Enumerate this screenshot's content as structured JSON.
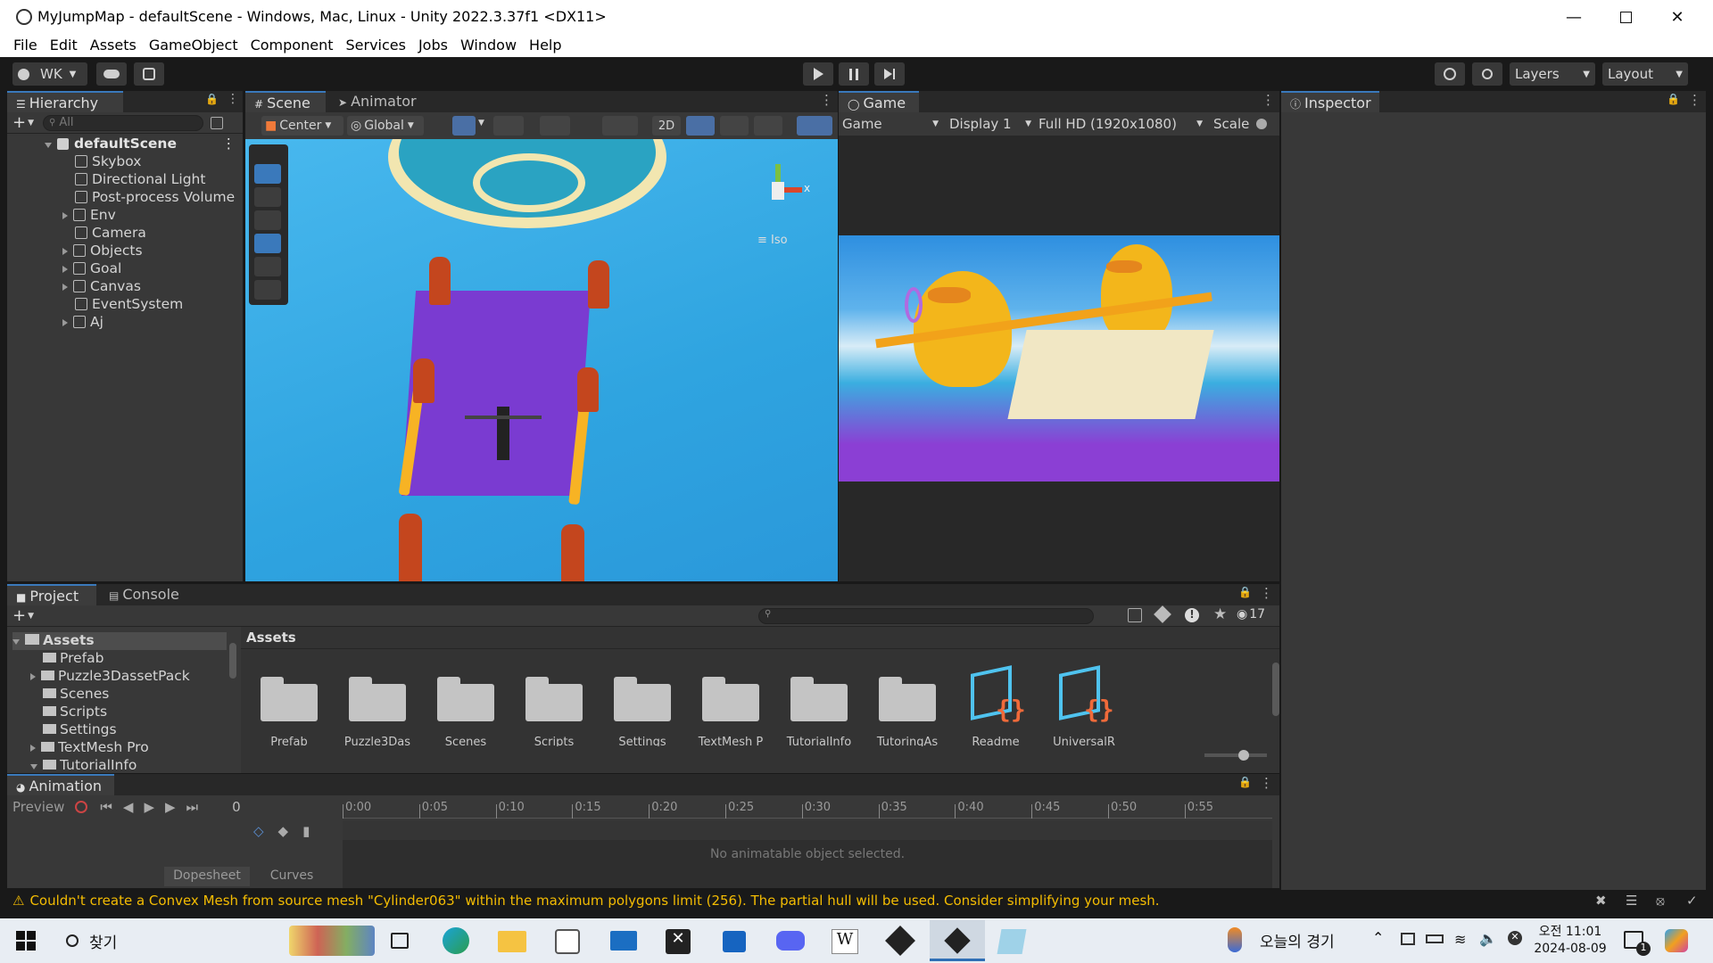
{
  "window": {
    "title": "MyJumpMap - defaultScene - Windows, Mac, Linux - Unity 2022.3.37f1 <DX11>",
    "controls": [
      "minimize",
      "maximize",
      "close"
    ]
  },
  "menu": [
    "File",
    "Edit",
    "Assets",
    "GameObject",
    "Component",
    "Services",
    "Jobs",
    "Window",
    "Help"
  ],
  "toolbar": {
    "account": "WK",
    "layers": "Layers",
    "layout": "Layout"
  },
  "hierarchy": {
    "tab": "Hierarchy",
    "search_placeholder": "All",
    "scene": "defaultScene",
    "items": [
      {
        "label": "Skybox",
        "expandable": false
      },
      {
        "label": "Directional Light",
        "expandable": false
      },
      {
        "label": "Post-process Volume",
        "expandable": false
      },
      {
        "label": "Env",
        "expandable": true
      },
      {
        "label": "Camera",
        "expandable": false
      },
      {
        "label": "Objects",
        "expandable": true
      },
      {
        "label": "Goal",
        "expandable": true
      },
      {
        "label": "Canvas",
        "expandable": true
      },
      {
        "label": "EventSystem",
        "expandable": false
      },
      {
        "label": "Aj",
        "expandable": true
      }
    ]
  },
  "scene": {
    "tabs": [
      "Scene",
      "Animator"
    ],
    "pivot": "Center",
    "space": "Global",
    "mode_2d": "2D",
    "view_label": "Iso",
    "gizmo_x": "x"
  },
  "game": {
    "tab": "Game",
    "mode": "Game",
    "display": "Display 1",
    "resolution": "Full HD (1920x1080)",
    "scale": "Scale"
  },
  "inspector": {
    "tab": "Inspector"
  },
  "project": {
    "tabs": [
      "Project",
      "Console"
    ],
    "hidden_count": "17",
    "tree_root": "Assets",
    "tree": [
      {
        "label": "Prefab",
        "expandable": false
      },
      {
        "label": "Puzzle3DassetPack",
        "expandable": true
      },
      {
        "label": "Scenes",
        "expandable": false
      },
      {
        "label": "Scripts",
        "expandable": false
      },
      {
        "label": "Settings",
        "expandable": false
      },
      {
        "label": "TextMesh Pro",
        "expandable": true
      },
      {
        "label": "TutorialInfo",
        "expandable": true
      }
    ],
    "breadcrumb": "Assets",
    "assets": [
      {
        "label": "Prefab",
        "kind": "folder"
      },
      {
        "label": "Puzzle3Das",
        "kind": "folder"
      },
      {
        "label": "Scenes",
        "kind": "folder"
      },
      {
        "label": "Scripts",
        "kind": "folder"
      },
      {
        "label": "Settings",
        "kind": "folder"
      },
      {
        "label": "TextMesh P",
        "kind": "folder"
      },
      {
        "label": "TutorialInfo",
        "kind": "folder"
      },
      {
        "label": "TutoringAs",
        "kind": "folder"
      },
      {
        "label": "Readme",
        "kind": "script"
      },
      {
        "label": "UniversalR",
        "kind": "script"
      }
    ]
  },
  "animation": {
    "tab": "Animation",
    "preview": "Preview",
    "frame": "0",
    "ticks": [
      "0:00",
      "0:05",
      "0:10",
      "0:15",
      "0:20",
      "0:25",
      "0:30",
      "0:35",
      "0:40",
      "0:45",
      "0:50",
      "0:55"
    ],
    "empty_message": "No animatable object selected.",
    "dopesheet": "Dopesheet",
    "curves": "Curves"
  },
  "statusbar": {
    "warning": "Couldn't create a Convex Mesh from source mesh \"Cylinder063\" within the maximum polygons limit (256). The partial hull will be used. Consider simplifying your mesh."
  },
  "taskbar": {
    "search": "찾기",
    "weather": "오늘의 경기",
    "time": "오전 11:01",
    "date": "2024-08-09",
    "notification_count": "1"
  },
  "colors": {
    "accent": "#3a79bb",
    "warning": "#f4bc02",
    "scene_sky": "#3fb2e6",
    "purple": "#7a3bd1"
  }
}
